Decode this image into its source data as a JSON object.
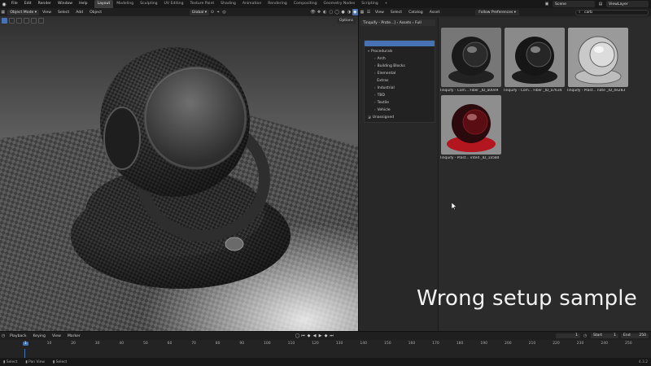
{
  "topbar": {
    "menus": [
      "File",
      "Edit",
      "Render",
      "Window",
      "Help"
    ],
    "workspaces": [
      "Layout",
      "Modeling",
      "Sculpting",
      "UV Editing",
      "Texture Paint",
      "Shading",
      "Animation",
      "Rendering",
      "Compositing",
      "Geometry Nodes",
      "Scripting"
    ],
    "active_workspace": "Layout",
    "scene": "Scene",
    "view_layer": "ViewLayer"
  },
  "viewport": {
    "mode": "Object Mode",
    "menus": [
      "View",
      "Select",
      "Add",
      "Object"
    ],
    "orientation": "Global",
    "options_label": "Options"
  },
  "asset_browser": {
    "menus": [
      "View",
      "Select",
      "Catalog",
      "Asset"
    ],
    "import_method": "Follow Preferences",
    "search_value": "carb",
    "library_path": "Tinquify - Prote...]  ›  Assets  ›  Full",
    "catalog_search": "",
    "catalogs": [
      {
        "label": "Procedurals",
        "expanded": true,
        "level": 0
      },
      {
        "label": "Arch",
        "level": 1
      },
      {
        "label": "Building Blocks",
        "level": 1
      },
      {
        "label": "Elemental",
        "level": 1
      },
      {
        "label": "Extras",
        "level": 1
      },
      {
        "label": "Industrial",
        "level": 1
      },
      {
        "label": "TBD",
        "level": 1
      },
      {
        "label": "Textile",
        "level": 1
      },
      {
        "label": "Vehicle",
        "level": 1
      },
      {
        "label": "Unassigned",
        "level": 0
      }
    ],
    "assets": [
      {
        "name": "Tinquify - Com... Fiber _ID_a00e9"
      },
      {
        "name": "Tinquify - Com... Fiber _ID_a7634"
      },
      {
        "name": "Tinquify - Plast... nate _ID_4e283"
      },
      {
        "name": "Tinquify - Plast... inted _ID_1a58d"
      }
    ]
  },
  "overlay_caption": "Wrong setup sample",
  "timeline": {
    "menus": [
      "Playback",
      "Keying",
      "View",
      "Marker"
    ],
    "current_frame": "1",
    "start_label": "Start",
    "start_value": "1",
    "end_label": "End",
    "end_value": "250",
    "ticks": [
      "1",
      "10",
      "20",
      "30",
      "40",
      "50",
      "60",
      "70",
      "80",
      "90",
      "100",
      "110",
      "120",
      "130",
      "140",
      "150",
      "160",
      "170",
      "180",
      "190",
      "200",
      "210",
      "220",
      "230",
      "240",
      "250"
    ]
  },
  "statusbar": {
    "items": [
      "Select",
      "Pan View",
      "Select"
    ],
    "version": "4.3.2"
  },
  "colors": {
    "accent": "#4772b3",
    "red_material": "#b3161f"
  }
}
